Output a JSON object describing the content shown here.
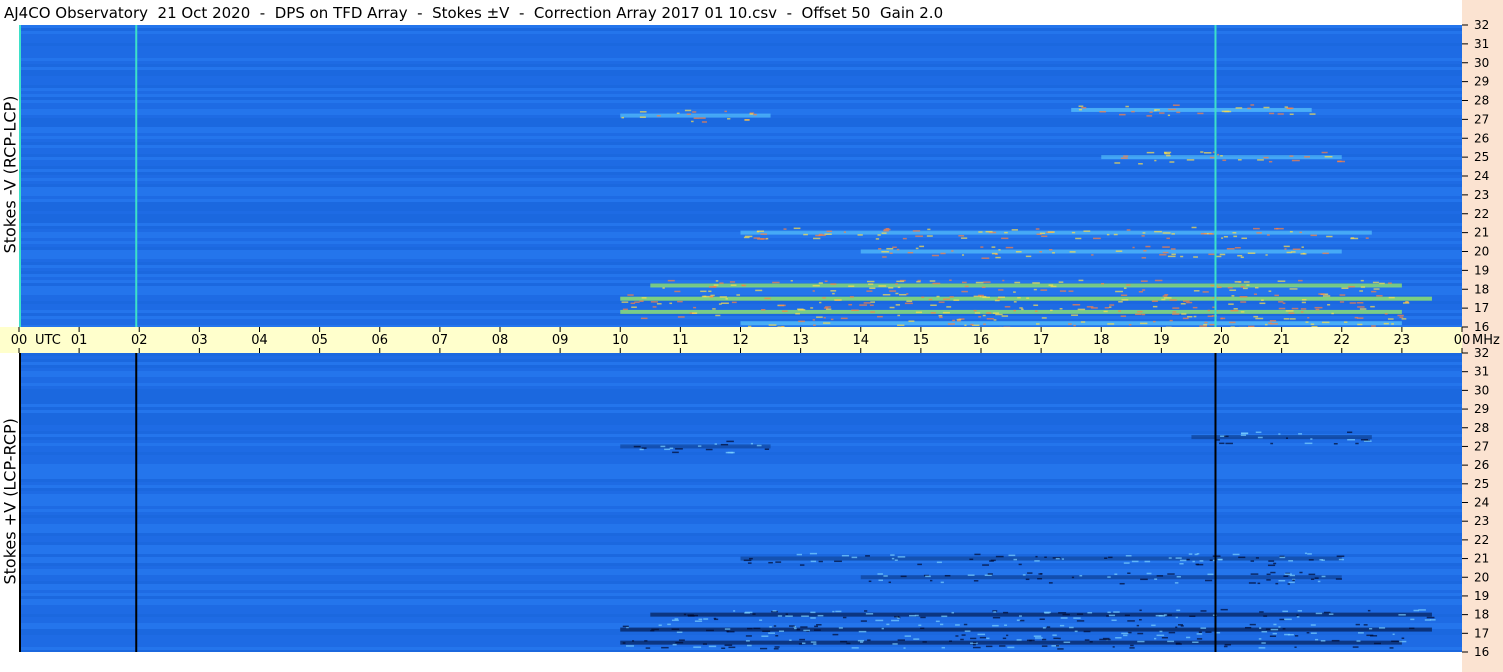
{
  "title": "AJ4CO Observatory  21 Oct 2020  -  DPS on TFD Array  -  Stokes ±V  -  Correction Array 2017 01 10.csv  -  Offset 50  Gain 2.0",
  "chart_data": [
    {
      "type": "heatmap",
      "panel": "top",
      "ylabel": "Stokes -V (RCP-LCP)",
      "y_unit": "MHz",
      "ylim": [
        16,
        32
      ],
      "y_ticks": [
        "16",
        "17",
        "18",
        "19",
        "20",
        "21",
        "22",
        "23",
        "24",
        "25",
        "26",
        "27",
        "28",
        "29",
        "30",
        "31",
        "32"
      ],
      "xlim_utc_hours": [
        0,
        24
      ],
      "background_color": "#1e6ee6",
      "vertical_markers_utc": [
        0.0,
        1.95,
        19.9
      ],
      "marker_color": "#3de0c8",
      "activity": [
        {
          "utc_start": 10.0,
          "utc_end": 12.5,
          "mhz": 27.2,
          "intensity": 0.6
        },
        {
          "utc_start": 17.5,
          "utc_end": 21.5,
          "mhz": 27.5,
          "intensity": 0.7
        },
        {
          "utc_start": 18.0,
          "utc_end": 22.0,
          "mhz": 25.0,
          "intensity": 0.5
        },
        {
          "utc_start": 12.0,
          "utc_end": 22.5,
          "mhz": 21.0,
          "intensity": 0.6
        },
        {
          "utc_start": 14.0,
          "utc_end": 22.0,
          "mhz": 20.0,
          "intensity": 0.6
        },
        {
          "utc_start": 10.5,
          "utc_end": 23.0,
          "mhz": 18.2,
          "intensity": 0.9
        },
        {
          "utc_start": 10.0,
          "utc_end": 23.5,
          "mhz": 17.5,
          "intensity": 1.0
        },
        {
          "utc_start": 10.0,
          "utc_end": 23.0,
          "mhz": 16.8,
          "intensity": 0.9
        },
        {
          "utc_start": 12.0,
          "utc_end": 23.0,
          "mhz": 16.2,
          "intensity": 0.8
        }
      ]
    },
    {
      "type": "heatmap",
      "panel": "bottom",
      "ylabel": "Stokes +V (LCP-RCP)",
      "y_unit": "MHz",
      "ylim": [
        16,
        32
      ],
      "y_ticks": [
        "16",
        "17",
        "18",
        "19",
        "20",
        "21",
        "22",
        "23",
        "24",
        "25",
        "26",
        "27",
        "28",
        "29",
        "30",
        "31",
        "32"
      ],
      "xlim_utc_hours": [
        0,
        24
      ],
      "background_color": "#1e6ee6",
      "vertical_markers_utc": [
        0.0,
        1.95,
        19.9
      ],
      "marker_color": "#000000",
      "activity": [
        {
          "utc_start": 10.0,
          "utc_end": 12.5,
          "mhz": 27.0,
          "intensity": 0.5
        },
        {
          "utc_start": 19.5,
          "utc_end": 22.5,
          "mhz": 27.5,
          "intensity": 0.7
        },
        {
          "utc_start": 12.0,
          "utc_end": 22.0,
          "mhz": 21.0,
          "intensity": 0.6
        },
        {
          "utc_start": 14.0,
          "utc_end": 22.0,
          "mhz": 20.0,
          "intensity": 0.6
        },
        {
          "utc_start": 10.5,
          "utc_end": 23.5,
          "mhz": 18.0,
          "intensity": 0.9
        },
        {
          "utc_start": 10.0,
          "utc_end": 23.5,
          "mhz": 17.2,
          "intensity": 1.0
        },
        {
          "utc_start": 10.0,
          "utc_end": 23.0,
          "mhz": 16.5,
          "intensity": 0.9
        }
      ]
    }
  ],
  "time_axis": {
    "labels": [
      "00",
      "UTC",
      "01",
      "02",
      "03",
      "04",
      "05",
      "06",
      "07",
      "08",
      "09",
      "10",
      "11",
      "12",
      "13",
      "14",
      "15",
      "16",
      "17",
      "18",
      "19",
      "20",
      "21",
      "22",
      "23",
      "00",
      "MHz"
    ],
    "hours": [
      "00",
      "01",
      "02",
      "03",
      "04",
      "05",
      "06",
      "07",
      "08",
      "09",
      "10",
      "11",
      "12",
      "13",
      "14",
      "15",
      "16",
      "17",
      "18",
      "19",
      "20",
      "21",
      "22",
      "23",
      "00"
    ],
    "unit_label_left": "UTC",
    "unit_label_right": "MHz"
  }
}
